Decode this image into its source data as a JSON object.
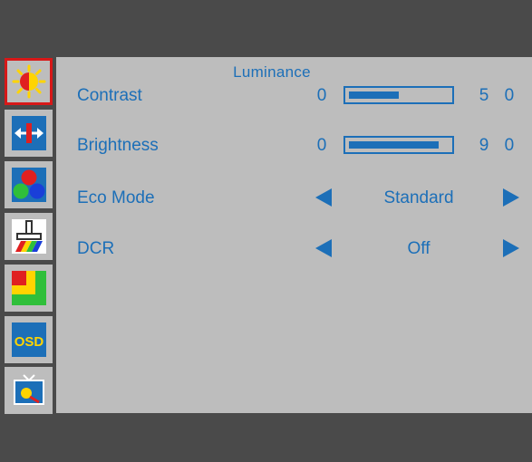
{
  "osd": {
    "title": "Luminance",
    "sidebar": [
      {
        "name": "luminance-icon",
        "selected": true
      },
      {
        "name": "image-setup-icon",
        "selected": false
      },
      {
        "name": "color-temp-icon",
        "selected": false
      },
      {
        "name": "picture-boost-icon",
        "selected": false
      },
      {
        "name": "color-boost-icon",
        "selected": false
      },
      {
        "name": "osd-setup-icon",
        "selected": false
      },
      {
        "name": "extra-icon",
        "selected": false
      }
    ],
    "contrast": {
      "label": "Contrast",
      "min": "0",
      "value": "5 0",
      "fill": 0.5
    },
    "brightness": {
      "label": "Brightness",
      "min": "0",
      "value": "9 0",
      "fill": 0.9
    },
    "eco_mode": {
      "label": "Eco Mode",
      "value": "Standard"
    },
    "dcr": {
      "label": "DCR",
      "value": "Off"
    },
    "osd_icon_text": "OSD",
    "colors": {
      "accent": "#1c6fb8",
      "selection": "#d81818",
      "panel": "#bdbdbd",
      "frame": "#4a4a4a"
    }
  }
}
